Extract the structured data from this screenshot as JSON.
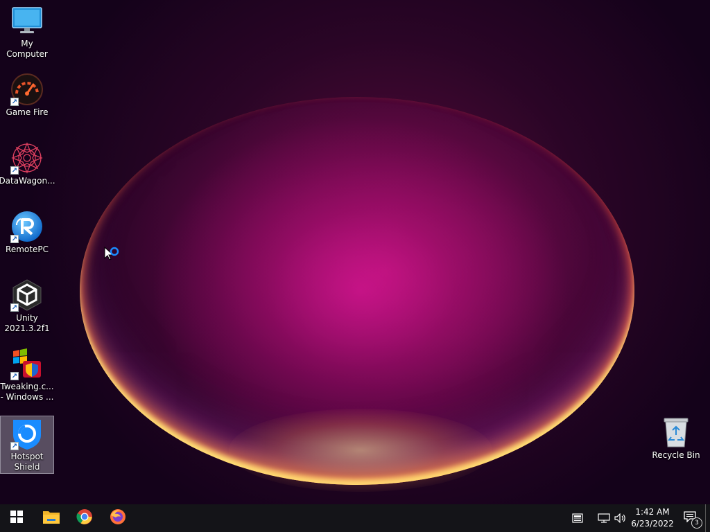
{
  "desktop": {
    "icons": [
      {
        "label": "My Computer",
        "icon": "monitor-icon"
      },
      {
        "label": "Game Fire",
        "icon": "speedometer-icon"
      },
      {
        "label": "DataWagon...",
        "icon": "mandala-icon"
      },
      {
        "label": "RemotePC",
        "icon": "remotepc-icon"
      },
      {
        "label": "Unity\n2021.3.2f1",
        "icon": "unity-icon"
      },
      {
        "label": "Tweaking.c...\n- Windows ...",
        "icon": "windows-repair-icon"
      },
      {
        "label": "Hotspot\nShield",
        "icon": "shield-icon"
      },
      {
        "label": "Recycle Bin",
        "icon": "recycle-bin-icon"
      }
    ],
    "shortcut_glyph": "↗"
  },
  "taskbar": {
    "pinned": [
      {
        "name": "start-button",
        "icon": "windows-logo-icon"
      },
      {
        "name": "file-explorer",
        "icon": "folder-icon"
      },
      {
        "name": "google-chrome",
        "icon": "chrome-icon"
      },
      {
        "name": "firefox",
        "icon": "firefox-icon"
      }
    ],
    "tray": {
      "time": "1:42 AM",
      "date": "6/23/2022",
      "notification_count": "3"
    }
  },
  "colors": {
    "taskbar_bg": "#141418",
    "accent_blue": "#1a8cff",
    "wallpaper_magenta": "#c8108c"
  }
}
